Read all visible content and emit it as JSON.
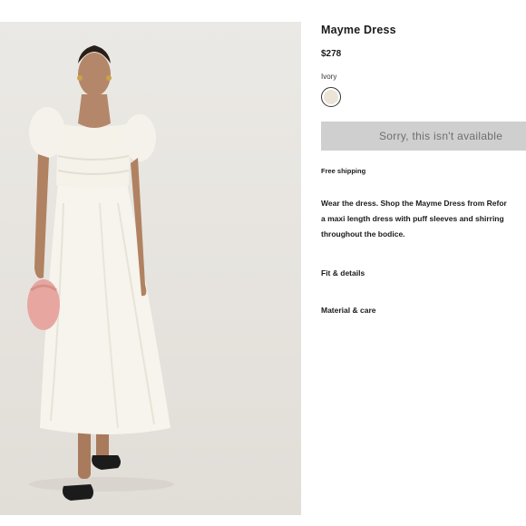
{
  "product": {
    "title": "Mayme Dress",
    "price": "$278",
    "color_name": "Ivory",
    "swatch_color": "#ece4d6",
    "availability_button": "Sorry, this isn't available",
    "shipping": "Free shipping",
    "description_lines": [
      "Wear the dress. Shop the Mayme Dress from Refor",
      "a maxi length dress with puff sleeves and shirring",
      "throughout the bodice."
    ],
    "accordions": [
      {
        "label": "Fit & details"
      },
      {
        "label": "Material & care"
      }
    ]
  }
}
